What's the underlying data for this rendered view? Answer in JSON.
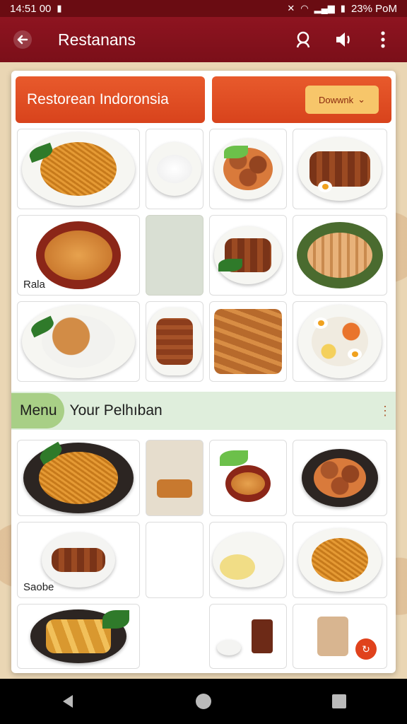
{
  "status_bar": {
    "time": "14:51 00",
    "right_text": "23% PoM",
    "colors": {
      "background": "#6a0c12"
    }
  },
  "app_bar": {
    "title": "Restanans",
    "icons": {
      "back": "arrow-left-icon",
      "search": "search-icon",
      "sound": "speaker-icon",
      "more": "more-vert-icon"
    },
    "color": "#8e1420"
  },
  "header": {
    "title": "Restorean Indoronsia",
    "dropdown_label": "Dowwnk"
  },
  "top_grid": {
    "tiles": [
      {
        "dish": "mie-goreng",
        "label": ""
      },
      {
        "dish": "nasi-putih",
        "label": ""
      },
      {
        "dish": "semur-bakso",
        "label": ""
      },
      {
        "dish": "sate-telur",
        "label": ""
      },
      {
        "dish": "soto-bowl",
        "label": "Rala"
      },
      {
        "dish": "blank",
        "label": ""
      },
      {
        "dish": "sate-daun",
        "label": ""
      },
      {
        "dish": "ikan-bakar",
        "label": ""
      },
      {
        "dish": "nasi-ayam",
        "label": ""
      },
      {
        "dish": "ayam-panggang",
        "label": ""
      },
      {
        "dish": "tempe-tahu",
        "label": ""
      },
      {
        "dish": "nasi-campur",
        "label": ""
      }
    ]
  },
  "section": {
    "pill_text": "Menu",
    "rest_text": "Your Pelhıban",
    "more_icon": "more-vert-icon"
  },
  "bottom_grid": {
    "tiles": [
      {
        "dish": "mie-goreng",
        "label": ""
      },
      {
        "dish": "lumpia",
        "label": ""
      },
      {
        "dish": "sup-merah",
        "label": ""
      },
      {
        "dish": "sate-bakso",
        "label": ""
      },
      {
        "dish": "sate-bowl",
        "label": "Saobe"
      },
      {
        "dish": "blank",
        "label": ""
      },
      {
        "dish": "martabak",
        "label": ""
      },
      {
        "dish": "mie-goreng-2",
        "label": ""
      },
      {
        "dish": "pisang-goreng",
        "label": ""
      },
      {
        "dish": "empty",
        "label": ""
      },
      {
        "dish": "minuman",
        "label": ""
      },
      {
        "dish": "kopi",
        "label": ""
      }
    ]
  },
  "fab_icon": "refresh-icon",
  "nav_bar": {
    "back": "back-triangle-icon",
    "home": "home-circle-icon",
    "recents": "recents-square-icon"
  }
}
